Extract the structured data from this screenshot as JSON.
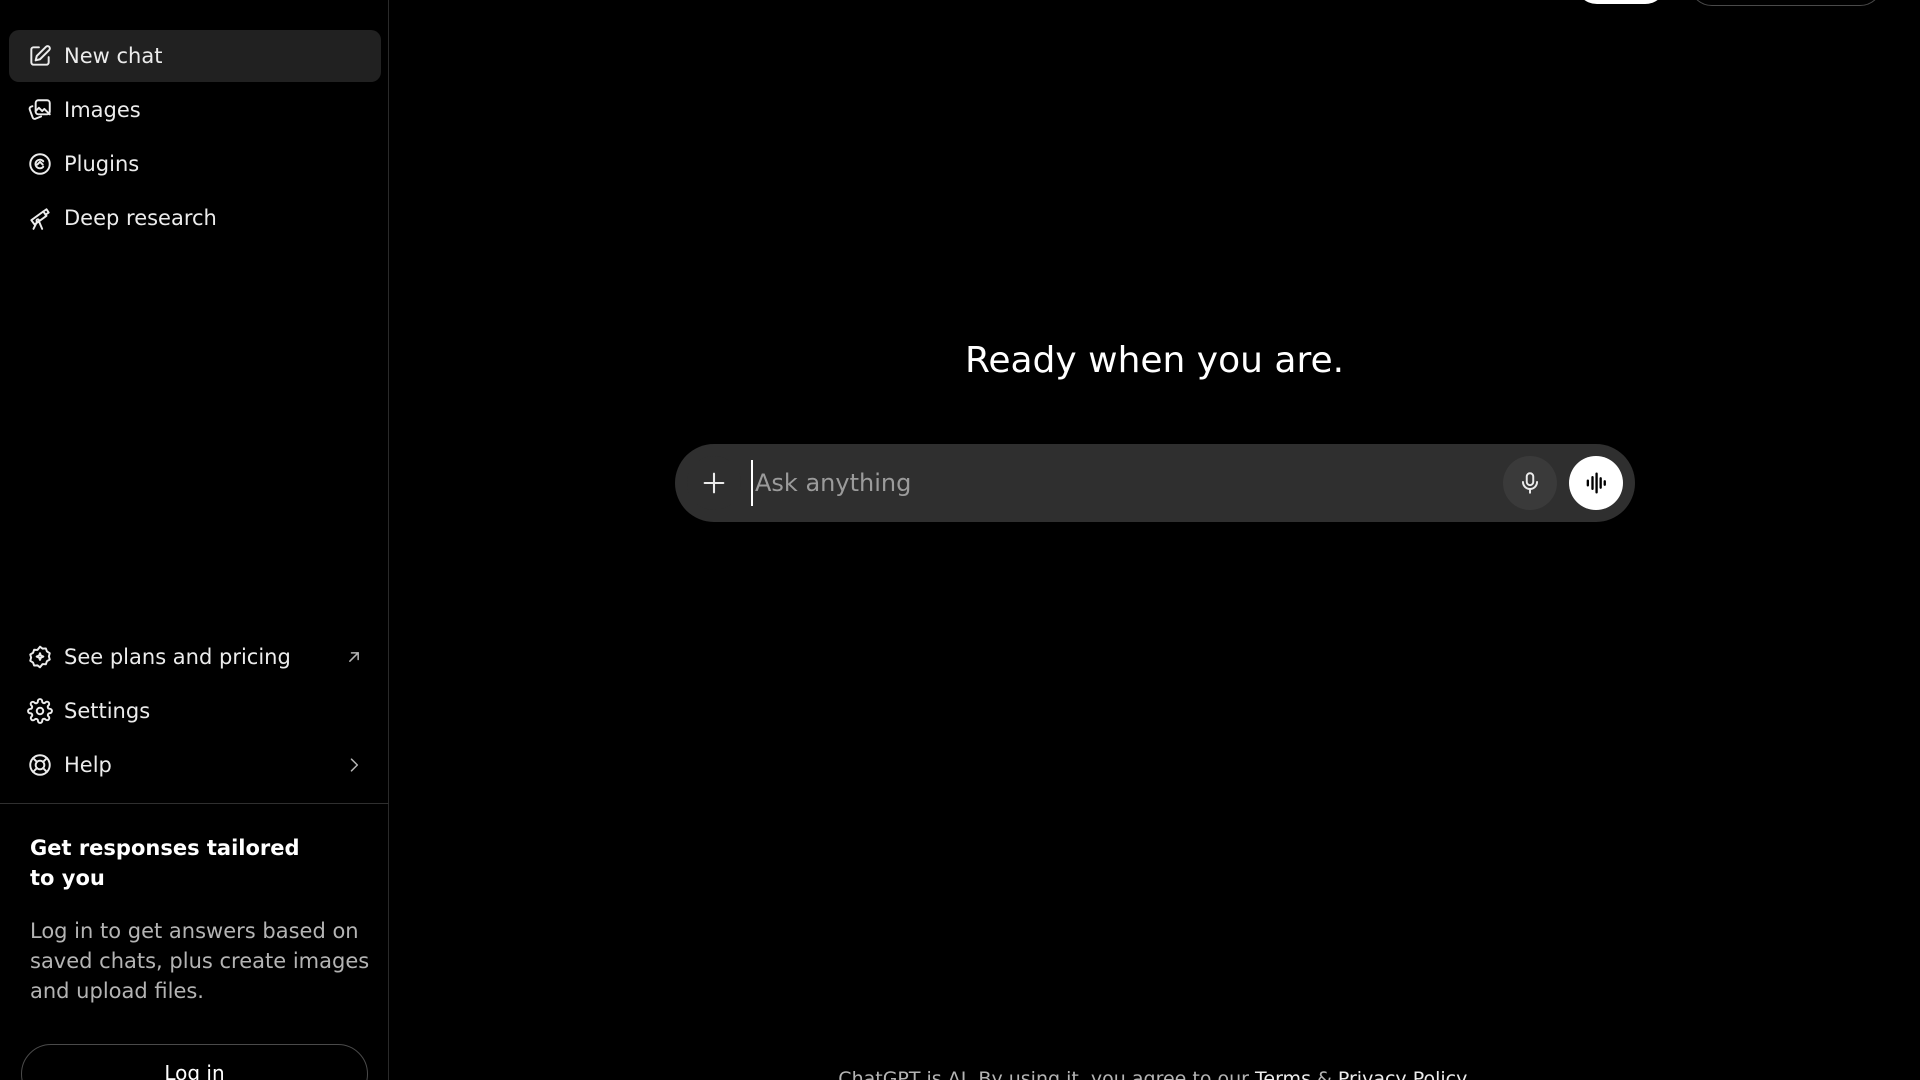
{
  "sidebar": {
    "top_items": [
      {
        "label": "New chat",
        "icon": "compose-icon"
      },
      {
        "label": "Images",
        "icon": "images-icon"
      },
      {
        "label": "Plugins",
        "icon": "plugins-icon"
      },
      {
        "label": "Deep research",
        "icon": "telescope-icon"
      }
    ],
    "bottom_items": [
      {
        "label": "See plans and pricing",
        "icon": "plans-badge-icon",
        "trailing_icon": "external-arrow-icon"
      },
      {
        "label": "Settings",
        "icon": "gear-icon"
      },
      {
        "label": "Help",
        "icon": "lifebuoy-icon",
        "trailing_icon": "chevron-right-icon"
      }
    ],
    "promo": {
      "title": "Get responses tailored to you",
      "text": "Log in to get answers based on saved chats, plus create images and upload files.",
      "login_label": "Log in"
    }
  },
  "main": {
    "headline": "Ready when you are.",
    "composer": {
      "placeholder": "Ask anything",
      "value": ""
    },
    "footer": {
      "prefix": "ChatGPT is AI. By using it, you agree to our ",
      "terms": "Terms",
      "amp": " & ",
      "privacy": "Privacy Policy",
      "suffix": "."
    }
  },
  "colors": {
    "background": "#000000",
    "sidebar_active": "#212121",
    "composer_bg": "#2f2f2f",
    "text": "#ececec",
    "muted_text": "#b4b4b4"
  }
}
